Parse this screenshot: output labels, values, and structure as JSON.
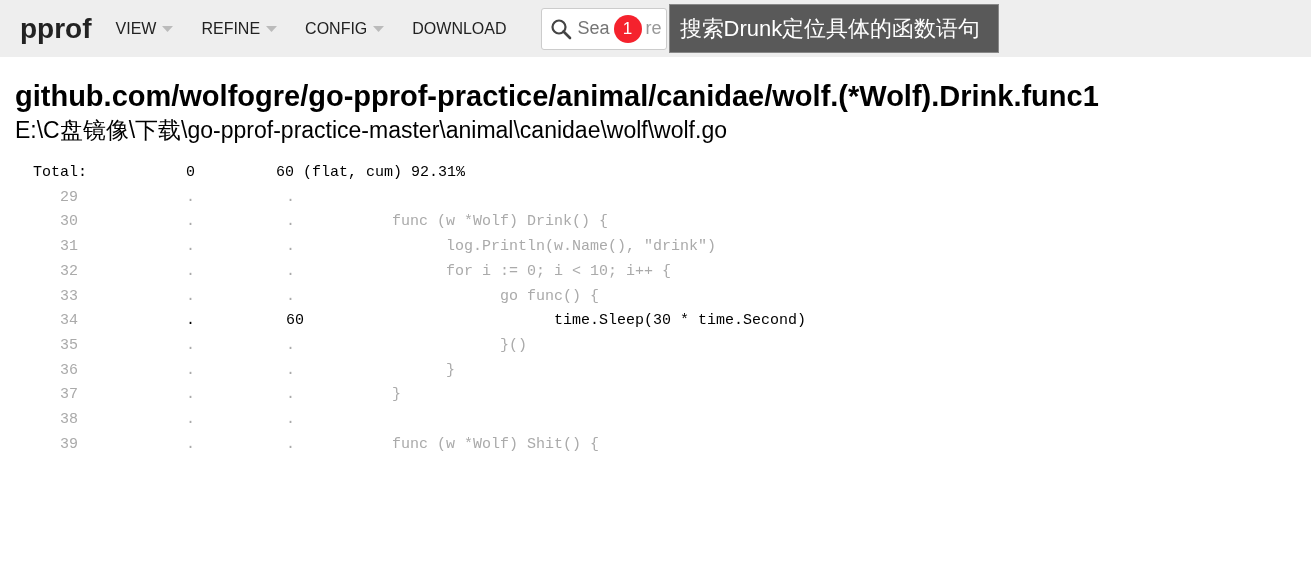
{
  "header": {
    "logo": "pprof",
    "menu": [
      {
        "label": "VIEW",
        "kind": "dropdown"
      },
      {
        "label": "REFINE",
        "kind": "dropdown"
      },
      {
        "label": "CONFIG",
        "kind": "dropdown"
      },
      {
        "label": "DOWNLOAD",
        "kind": "link"
      }
    ],
    "search": {
      "placeholder": "Sea",
      "placeholder_rest": "re"
    },
    "annotation": {
      "badge": "1",
      "text": "搜索Drunk定位具体的函数语句"
    }
  },
  "function": {
    "name": "github.com/wolfogre/go-pprof-practice/animal/canidae/wolf.(*Wolf).Drink.func1",
    "file": "E:\\C盘镜像\\下载\\go-pprof-practice-master\\animal\\canidae\\wolf\\wolf.go"
  },
  "listing": {
    "total": {
      "label": "Total:",
      "flat": "0",
      "cum": "60",
      "summary": "(flat, cum) 92.31%"
    },
    "lines": [
      {
        "line": "29",
        "flat": ".",
        "cum": ".",
        "hot": false
      },
      {
        "line": "30",
        "flat": ".",
        "cum": ".",
        "source": "\tfunc (w *Wolf) Drink() {",
        "hot": false
      },
      {
        "line": "31",
        "flat": ".",
        "cum": ".",
        "source": "\t\tlog.Println(w.Name(), \"drink\")",
        "hot": false
      },
      {
        "line": "32",
        "flat": ".",
        "cum": ".",
        "source": "\t\tfor i := 0; i < 10; i++ {",
        "hot": false
      },
      {
        "line": "33",
        "flat": ".",
        "cum": ".",
        "source": "\t\t\tgo func() {",
        "hot": false
      },
      {
        "line": "34",
        "flat": ".",
        "cum": "60",
        "source": "\t\t\t\ttime.Sleep(30 * time.Second)",
        "hot": true
      },
      {
        "line": "35",
        "flat": ".",
        "cum": ".",
        "source": "\t\t\t}()",
        "hot": false
      },
      {
        "line": "36",
        "flat": ".",
        "cum": ".",
        "source": "\t\t}",
        "hot": false
      },
      {
        "line": "37",
        "flat": ".",
        "cum": ".",
        "source": "\t}",
        "hot": false
      },
      {
        "line": "38",
        "flat": ".",
        "cum": ".",
        "hot": false
      },
      {
        "line": "39",
        "flat": ".",
        "cum": ".",
        "source": "\tfunc (w *Wolf) Shit() {",
        "hot": false
      }
    ]
  }
}
